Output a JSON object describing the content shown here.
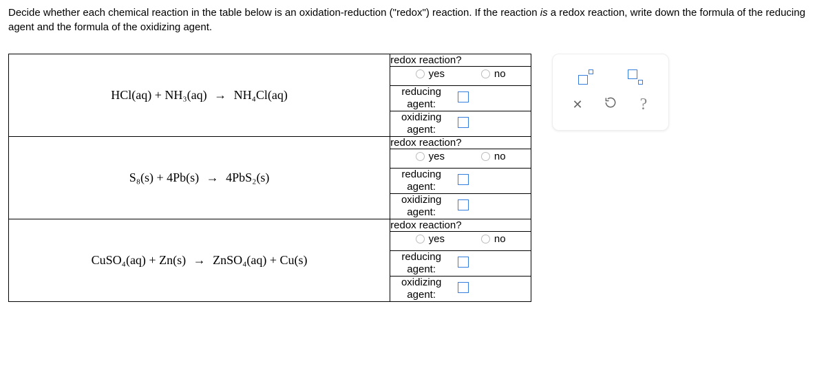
{
  "instructions": {
    "part1": "Decide whether each chemical reaction in the table below is an oxidation-reduction (\"redox\") reaction. If the reaction ",
    "em": "is",
    "part2": " a redox reaction, write down the formula of the reducing agent and the formula of the oxidizing agent."
  },
  "headers": {
    "redox_q": "redox reaction?",
    "yes": "yes",
    "no": "no",
    "reducing": "reducing agent:",
    "oxidizing": "oxidizing agent:"
  },
  "reactions": [
    {
      "id": "r1",
      "lhs": "HCl(aq) + NH₃(aq)",
      "rhs": "NH₄Cl(aq)"
    },
    {
      "id": "r2",
      "lhs": "S₈(s) + 4Pb(s)",
      "rhs": "4PbS₂(s)"
    },
    {
      "id": "r3",
      "lhs": "CuSO₄(aq) + Zn(s)",
      "rhs": "ZnSO₄(aq) + Cu(s)"
    }
  ],
  "palette": {
    "superscript": "superscript-template",
    "subscript": "subscript-template",
    "clear": "clear",
    "reset": "reset",
    "help": "?"
  }
}
